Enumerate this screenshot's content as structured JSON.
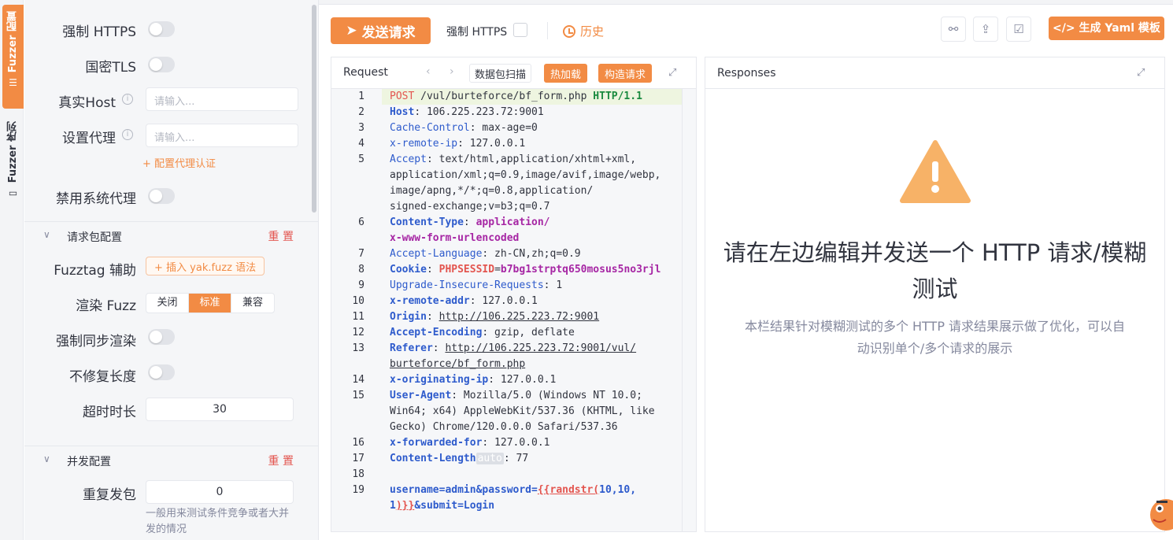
{
  "vtabs": {
    "active": "Fuzzer 配置",
    "inactive": "Fuzzer 序列"
  },
  "config": {
    "force_https": "强制 HTTPS",
    "gm_tls": "国密TLS",
    "real_host": "真实Host",
    "real_host_placeholder": "请输入...",
    "proxy": "设置代理",
    "proxy_placeholder": "请输入...",
    "proxy_auth_link": "+ 配置代理认证",
    "disable_system_proxy": "禁用系统代理",
    "request_section": "请求包配置",
    "reset": "重 置",
    "fuzztag_helper": "Fuzztag 辅助",
    "insert_fuzz": "+ 插入 yak.fuzz 语法",
    "render_fuzz": "渲染 Fuzz",
    "render_options": [
      "关闭",
      "标准",
      "兼容"
    ],
    "render_selected": "标准",
    "force_sync_render": "强制同步渲染",
    "no_fix_length": "不修复长度",
    "timeout": "超时时长",
    "timeout_value": "30",
    "concurrency_section": "并发配置",
    "repeat_send": "重复发包",
    "repeat_value": "0",
    "repeat_hint": "一般用来测试条件竞争或者大并发的情况"
  },
  "toolbar": {
    "send": "发送请求",
    "force_https": "强制 HTTPS",
    "history": "历史",
    "gen_yaml": "</> 生成 Yaml 模板",
    "icons": [
      "share-icon",
      "upload-icon",
      "check-export-icon"
    ]
  },
  "request": {
    "title": "Request",
    "scan": "数据包扫描",
    "hot_reload": "热加载",
    "build": "构造请求"
  },
  "code_lines": [
    {
      "n": "1",
      "segments": [
        [
          "m",
          "POST"
        ],
        [
          "v",
          " /vul/burteforce/bf_form.php "
        ],
        [
          "vb",
          "HTTP/1.1"
        ]
      ]
    },
    {
      "n": "2",
      "segments": [
        [
          "kb",
          "Host"
        ],
        [
          "v",
          ": 106.225.223.72:9001"
        ]
      ]
    },
    {
      "n": "3",
      "segments": [
        [
          "k",
          "Cache-Control"
        ],
        [
          "v",
          ": max-age=0"
        ]
      ]
    },
    {
      "n": "4",
      "segments": [
        [
          "k",
          "x-remote-ip"
        ],
        [
          "v",
          ": 127.0.0.1"
        ]
      ]
    },
    {
      "n": "5",
      "segments": [
        [
          "k",
          "Accept"
        ],
        [
          "v",
          ": text/html,application/xhtml+xml,"
        ]
      ]
    },
    {
      "n": "",
      "segments": [
        [
          "v",
          "application/xml;q=0.9,image/avif,image/webp,"
        ]
      ]
    },
    {
      "n": "",
      "segments": [
        [
          "v",
          "image/apng,*/*;q=0.8,application/"
        ]
      ]
    },
    {
      "n": "",
      "segments": [
        [
          "v",
          "signed-exchange;v=b3;q=0.7"
        ]
      ]
    },
    {
      "n": "6",
      "segments": [
        [
          "kb",
          "Content-Type"
        ],
        [
          "v",
          ": "
        ],
        [
          "mag",
          "application/"
        ]
      ]
    },
    {
      "n": "",
      "segments": [
        [
          "mag",
          "x-www-form-urlencoded"
        ]
      ]
    },
    {
      "n": "7",
      "segments": [
        [
          "k",
          "Accept-Language"
        ],
        [
          "v",
          ": zh-CN,zh;q=0.9"
        ]
      ]
    },
    {
      "n": "8",
      "segments": [
        [
          "kb",
          "Cookie"
        ],
        [
          "v",
          ": "
        ],
        [
          "red",
          "PHPSESSID"
        ],
        [
          "v",
          "="
        ],
        [
          "mag",
          "b7bg1strptq650mosus5no3rjl"
        ]
      ]
    },
    {
      "n": "9",
      "segments": [
        [
          "k",
          "Upgrade-Insecure-Requests"
        ],
        [
          "v",
          ": 1"
        ]
      ]
    },
    {
      "n": "10",
      "segments": [
        [
          "kb",
          "x-remote-addr"
        ],
        [
          "v",
          ": 127.0.0.1"
        ]
      ]
    },
    {
      "n": "11",
      "segments": [
        [
          "kb",
          "Origin"
        ],
        [
          "v",
          ": "
        ],
        [
          "u",
          "http://106.225.223.72:9001"
        ]
      ]
    },
    {
      "n": "12",
      "segments": [
        [
          "kb",
          "Accept-Encoding"
        ],
        [
          "v",
          ": gzip, deflate"
        ]
      ]
    },
    {
      "n": "13",
      "segments": [
        [
          "kb",
          "Referer"
        ],
        [
          "v",
          ": "
        ],
        [
          "u",
          "http://106.225.223.72:9001/vul/"
        ]
      ]
    },
    {
      "n": "",
      "segments": [
        [
          "u",
          "burteforce/bf_form.php"
        ]
      ]
    },
    {
      "n": "14",
      "segments": [
        [
          "kb",
          "x-originating-ip"
        ],
        [
          "v",
          ": 127.0.0.1"
        ]
      ]
    },
    {
      "n": "15",
      "segments": [
        [
          "kb",
          "User-Agent"
        ],
        [
          "v",
          ": Mozilla/5.0 (Windows NT 10.0;"
        ]
      ]
    },
    {
      "n": "",
      "segments": [
        [
          "v",
          "Win64; x64) AppleWebKit/537.36 (KHTML, like"
        ]
      ]
    },
    {
      "n": "",
      "segments": [
        [
          "v",
          "Gecko) Chrome/120.0.0.0 Safari/537.36"
        ]
      ]
    },
    {
      "n": "16",
      "segments": [
        [
          "kb",
          "x-forwarded-for"
        ],
        [
          "v",
          ": 127.0.0.1"
        ]
      ]
    },
    {
      "n": "17",
      "segments": [
        [
          "kb",
          "Content-Length"
        ],
        [
          "chip",
          "auto"
        ],
        [
          "v",
          ": 77"
        ]
      ]
    },
    {
      "n": "18",
      "segments": []
    },
    {
      "n": "19",
      "segments": [
        [
          "body",
          "username=admin&password="
        ],
        [
          "ftag",
          "{{randstr("
        ],
        [
          "body",
          "10,10,"
        ]
      ]
    },
    {
      "n": "",
      "segments": [
        [
          "body",
          "1"
        ],
        [
          "ftag",
          ")}}"
        ],
        [
          "body",
          "&submit=Login"
        ]
      ]
    }
  ],
  "response": {
    "title": "Responses",
    "empty_title": "请在左边编辑并发送一个 HTTP 请求/模糊测试",
    "empty_desc": "本栏结果针对模糊测试的多个 HTTP 请求结果展示做了优化，可以自动识别单个/多个请求的展示"
  },
  "colors": {
    "accent": "#f28b44",
    "danger": "#e3554f",
    "warning_icon": "#f7b267"
  }
}
